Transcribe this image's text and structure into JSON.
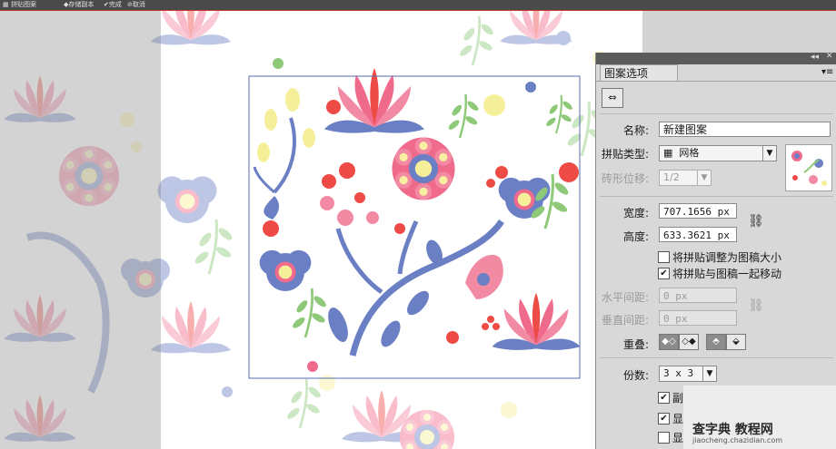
{
  "topbar": {
    "mode_label": "拼贴图案",
    "save_copy": "存储副本",
    "done": "完成",
    "cancel": "取消"
  },
  "panel": {
    "title": "图案选项",
    "name_label": "名称:",
    "name_value": "新建图案",
    "tile_type_label": "拼贴类型:",
    "tile_type_value": "网格",
    "brick_offset_label": "砖形位移:",
    "brick_offset_value": "1/2",
    "width_label": "宽度:",
    "width_value": "707.1656 px",
    "height_label": "高度:",
    "height_value": "633.3621 px",
    "size_to_art_label": "将拼贴调整为图稿大小",
    "size_to_art_checked": false,
    "move_with_art_label": "将拼贴与图稿一起移动",
    "move_with_art_checked": true,
    "h_spacing_label": "水平间距:",
    "h_spacing_value": "0 px",
    "v_spacing_label": "垂直间距:",
    "v_spacing_value": "0 px",
    "overlap_label": "重叠:",
    "copies_label": "份数:",
    "copies_value": "3 x 3",
    "copy_row1_label": "副",
    "copy_row1_checked": true,
    "copy_row2_label": "显",
    "copy_row2_checked": true,
    "copy_row3_label": "显",
    "copy_row3_checked": false
  },
  "watermark": {
    "line1": "查字典 教程网",
    "line2": "jiaocheng.chazidian.com"
  },
  "colors": {
    "panel_bg": "#d8d8d8",
    "tile_border": "#5a6ab0",
    "pink": "#f06a8c",
    "blue": "#6b7fc4",
    "red": "#ee4b46",
    "yellow": "#f4ee9a",
    "green": "#8ec97a"
  }
}
